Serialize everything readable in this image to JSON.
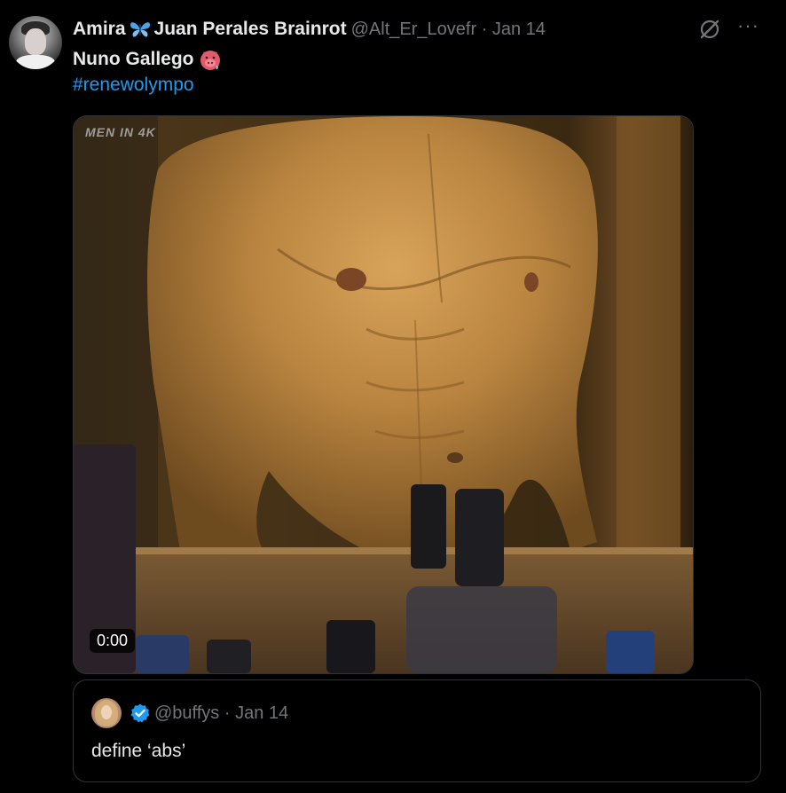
{
  "tweet": {
    "display_name_part1": "Amira",
    "display_name_part2": "Juan Perales Brainrot",
    "handle_meta": "@Alt_Er_Lovefr · Jan 14",
    "text_line1": "Nuno Gallego",
    "hashtag": "#renewolympo",
    "icons": {
      "name_emoji": "butterfly-icon",
      "text_emoji": "hot-face-icon",
      "grok": "grok-icon",
      "more": "more-icon"
    },
    "more_glyph": "···"
  },
  "media": {
    "watermark": "MEN IN 4K",
    "duration": "0:00"
  },
  "quote": {
    "handle_meta": "@buffys · Jan 14",
    "text": "define ‘abs’",
    "verified_icon": "verified-badge-icon"
  },
  "colors": {
    "background": "#000000",
    "text": "#e7e9ea",
    "muted": "#71767b",
    "link": "#1d9bf0",
    "border": "#2f3336"
  }
}
